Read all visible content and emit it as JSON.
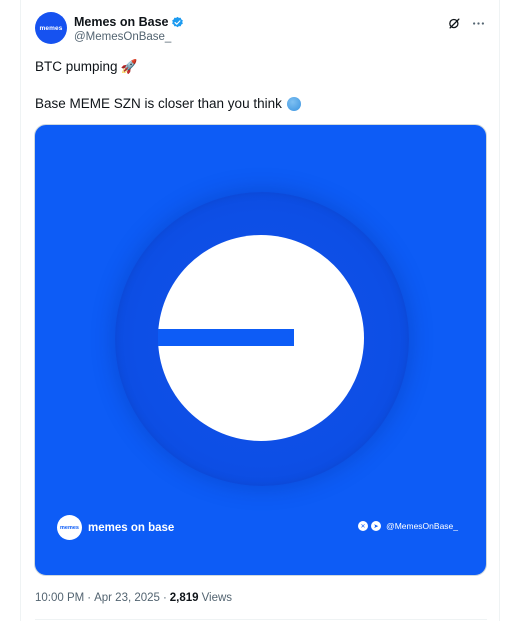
{
  "post": {
    "author": {
      "display_name": "Memes on Base",
      "handle": "@MemesOnBase_",
      "avatar_text": "memes",
      "verified": true,
      "verified_color": "#1d9bf0",
      "avatar_color": "#1652f0"
    },
    "header_actions": {
      "grok_icon": "grok-icon",
      "more_icon": "more-icon"
    },
    "text": {
      "line1": "BTC pumping",
      "line1_emoji": "🚀",
      "line2": "Base MEME SZN is closer than you think",
      "line2_emoji": "blue-circle"
    },
    "media": {
      "background_color": "#0d5cf6",
      "brand_logo_text": "memes",
      "brand_name": "memes on base",
      "social_handle": "@MemesOnBase_",
      "social_icons": [
        "x-icon",
        "telegram-icon"
      ]
    },
    "meta": {
      "time": "10:00 PM",
      "separator": "·",
      "date": "Apr 23, 2025",
      "views_count": "2,819",
      "views_label": "Views"
    }
  }
}
